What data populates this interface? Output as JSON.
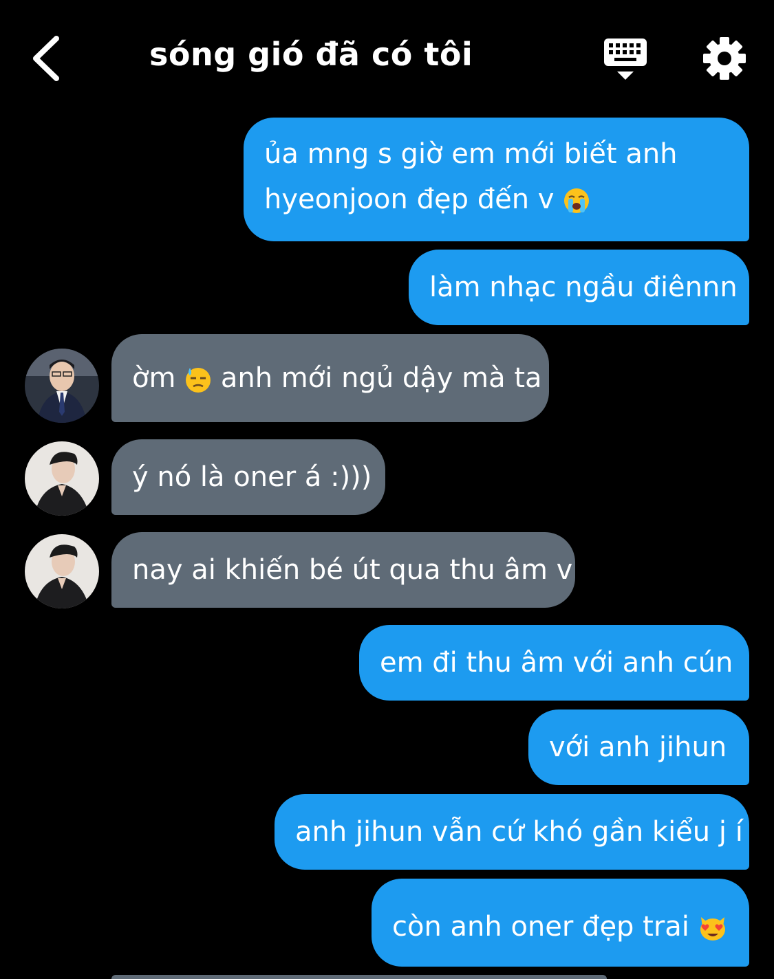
{
  "header": {
    "title": "sóng gió đã có tôi",
    "icons": {
      "back": "chevron-left-icon",
      "keyboard": "keyboard-icon",
      "settings": "gear-icon"
    }
  },
  "colors": {
    "background": "#000000",
    "sent_bubble": "#1d9bf0",
    "received_bubble": "#5f6b77",
    "text": "#ffffff"
  },
  "messages": [
    {
      "side": "sent",
      "lines": [
        "ủa mng s giờ em mới biết anh",
        "hyeonjoon đẹp đến v"
      ],
      "emoji": "loudly-crying-face-icon"
    },
    {
      "side": "sent",
      "text": "làm nhạc ngầu điênnn"
    },
    {
      "side": "received",
      "text_before": "ờm",
      "emoji": "downcast-face-with-sweat-icon",
      "text_after": "anh mới ngủ dậy mà ta",
      "avatar": "avatar-suit"
    },
    {
      "side": "received",
      "text": "ý nó là oner á :)))",
      "avatar": "avatar-jacket"
    },
    {
      "side": "received",
      "text": "nay ai khiến bé út qua thu âm v",
      "avatar": "avatar-jacket"
    },
    {
      "side": "sent",
      "text": "em đi thu âm với anh cún"
    },
    {
      "side": "sent",
      "text": "với anh jihun"
    },
    {
      "side": "sent",
      "text": "anh jihun vẫn cứ khó gần kiểu j í"
    },
    {
      "side": "sent",
      "text": "còn anh oner đẹp trai",
      "emoji": "smiling-cat-heart-eyes-icon"
    }
  ]
}
